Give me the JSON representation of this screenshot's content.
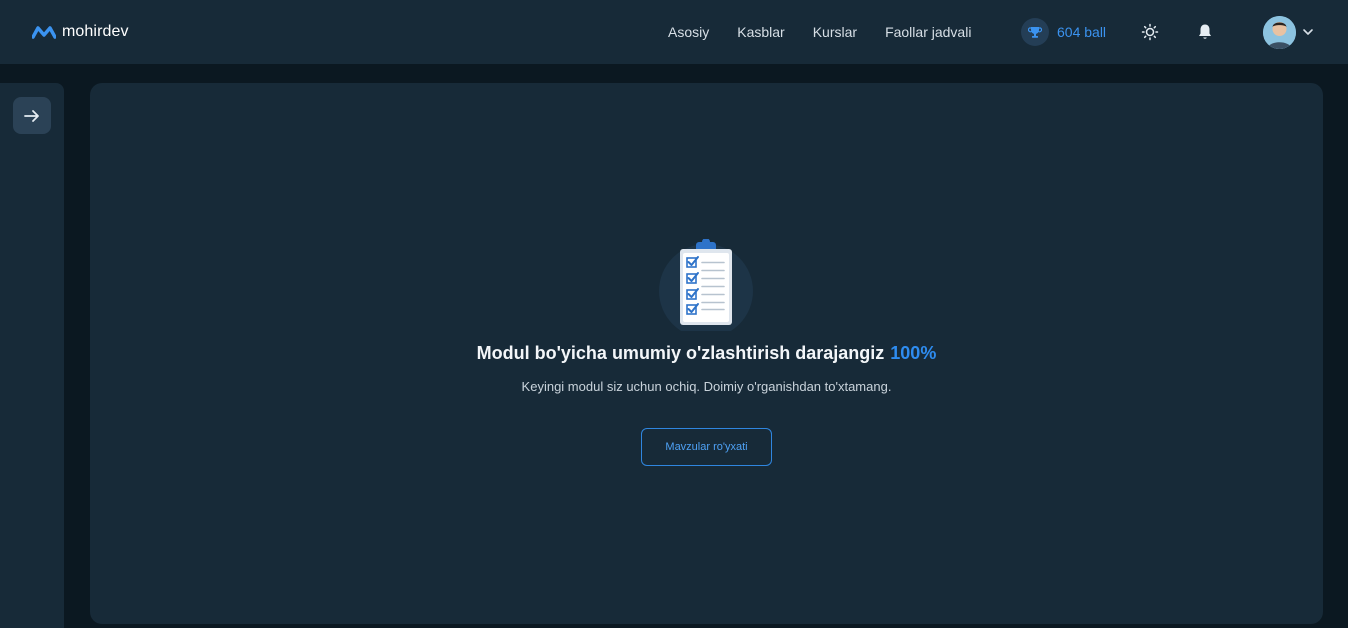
{
  "header": {
    "logo_text": "mohirdev",
    "nav": [
      {
        "label": "Asosiy"
      },
      {
        "label": "Kasblar"
      },
      {
        "label": "Kurslar"
      },
      {
        "label": "Faollar jadvali"
      }
    ],
    "score_label": "604 ball",
    "icons": {
      "score": "trophy-icon",
      "theme": "sun-icon",
      "notifications": "bell-icon",
      "menu": "chevron-down-icon"
    }
  },
  "sidebar": {
    "toggle_icon": "arrow-right-icon"
  },
  "main": {
    "headline": "Modul bo'yicha umumiy o'zlashtirish darajangiz",
    "percent": "100%",
    "subtext": "Keyingi modul siz uchun ochiq. Doimiy o'rganishdan to'xtamang.",
    "topics_button_label": "Mavzular ro'yxati",
    "illustration_icon": "checklist-clipboard-icon"
  },
  "colors": {
    "accent": "#2e8cf0",
    "header_bg": "#172a38",
    "page_bg": "#0b1821",
    "card_bg": "#172a38"
  }
}
